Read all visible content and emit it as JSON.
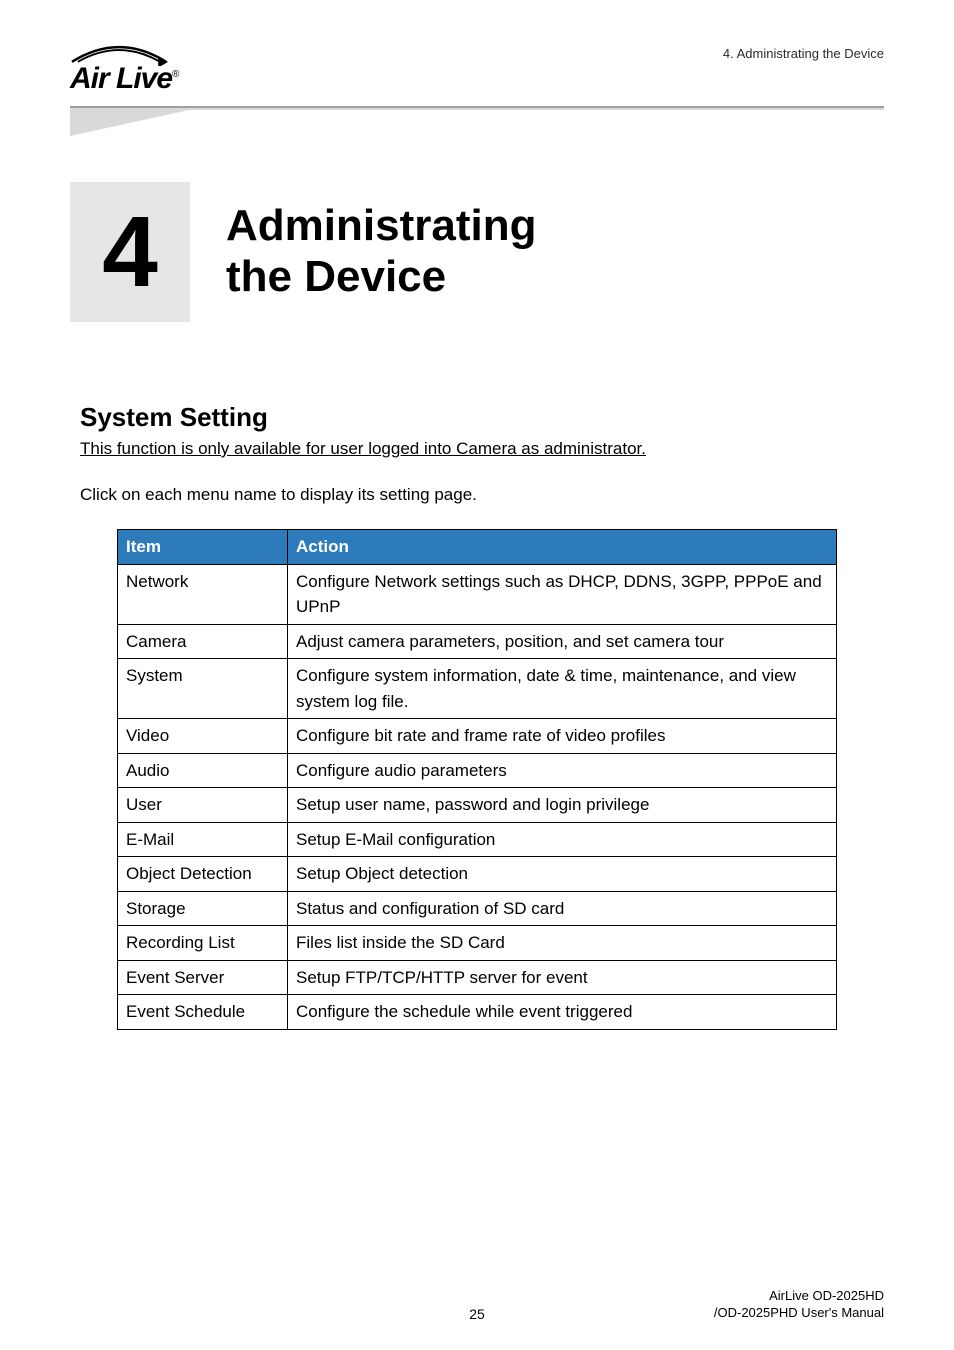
{
  "header": {
    "logo_text_main": "Air Live",
    "logo_text_r": "®",
    "crumb": "4. Administrating the Device"
  },
  "chapter": {
    "number": "4",
    "title_line1": "Administrating",
    "title_line2": "the Device"
  },
  "section": {
    "title": "System Setting",
    "intro_underline": "This function is only available for user logged into Camera as administrator.",
    "intro_plain": "Click on each menu name to display its setting page."
  },
  "table": {
    "head_item": "Item",
    "head_action": "Action",
    "rows": [
      {
        "item": "Network",
        "action": "Configure Network settings such as DHCP, DDNS, 3GPP, PPPoE and UPnP"
      },
      {
        "item": "Camera",
        "action": "Adjust camera parameters, position, and set camera tour"
      },
      {
        "item": "System",
        "action": "Configure system information, date & time, maintenance, and view system log file."
      },
      {
        "item": "Video",
        "action": "Configure bit rate and frame rate of video profiles"
      },
      {
        "item": "Audio",
        "action": "Configure audio parameters"
      },
      {
        "item": "User",
        "action": "Setup user name, password and login privilege"
      },
      {
        "item": "E-Mail",
        "action": "Setup E-Mail configuration"
      },
      {
        "item": "Object Detection",
        "action": "Setup Object detection"
      },
      {
        "item": "Storage",
        "action": "Status and configuration of SD card"
      },
      {
        "item": "Recording List",
        "action": "Files list inside the SD Card"
      },
      {
        "item": "Event Server",
        "action": "Setup FTP/TCP/HTTP server for event"
      },
      {
        "item": "Event Schedule",
        "action": "Configure the schedule while event triggered"
      }
    ]
  },
  "footer": {
    "page_num": "25",
    "right_line1": "AirLive OD-2025HD",
    "right_line2": "/OD-2025PHD User's Manual"
  }
}
